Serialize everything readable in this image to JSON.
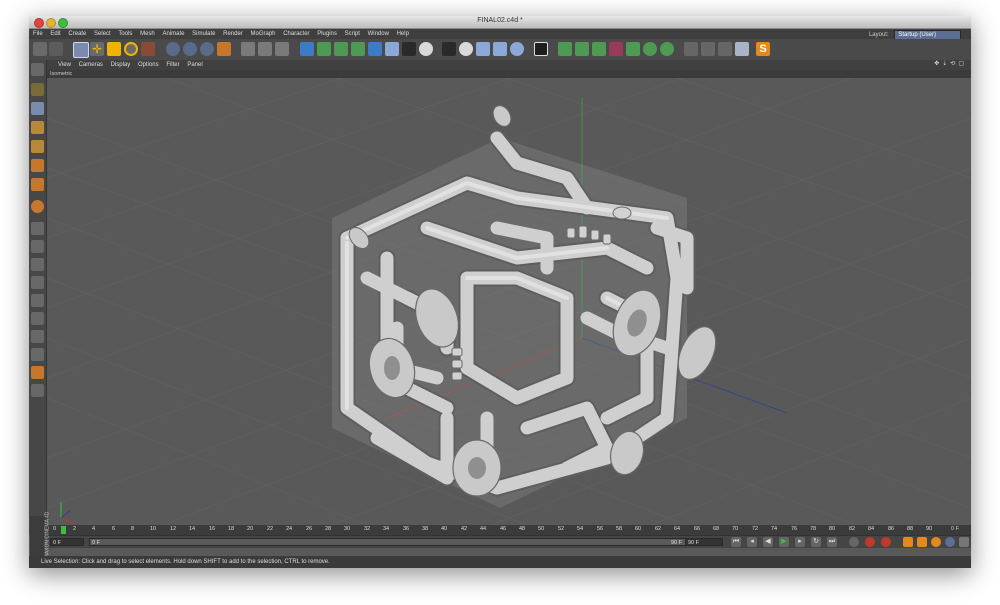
{
  "window": {
    "title": "FINAL02.c4d *"
  },
  "menubar": {
    "items": [
      "File",
      "Edit",
      "Create",
      "Select",
      "Tools",
      "Mesh",
      "Animate",
      "Simulate",
      "Render",
      "MoGraph",
      "Character",
      "Plugins",
      "Script",
      "Window",
      "Help"
    ],
    "layout_label": "Layout:",
    "layout_value": "Startup (User)"
  },
  "viewport_menu": {
    "items": [
      "View",
      "Cameras",
      "Display",
      "Options",
      "Filter",
      "Panel"
    ]
  },
  "viewport": {
    "name": "Isometric"
  },
  "timeline": {
    "ticks": [
      "0",
      "2",
      "4",
      "6",
      "8",
      "10",
      "12",
      "14",
      "16",
      "18",
      "20",
      "22",
      "24",
      "26",
      "28",
      "30",
      "32",
      "34",
      "36",
      "38",
      "40",
      "42",
      "44",
      "46",
      "48",
      "50",
      "52",
      "54",
      "56",
      "58",
      "60",
      "62",
      "64",
      "66",
      "68",
      "70",
      "72",
      "74",
      "76",
      "78",
      "80",
      "82",
      "84",
      "86",
      "88",
      "90"
    ],
    "current_frame": "0 F"
  },
  "transport": {
    "start_field": "0 F",
    "range_start": "0 F",
    "range_end": "90 F",
    "end_field": "90 F"
  },
  "brand": "MAXON CINEMA 4D",
  "status": {
    "text": "Live Selection: Click and drag to select elements. Hold down SHIFT to add to the selection, CTRL to remove."
  },
  "colors": {
    "accent": "#5a6f93",
    "viewport": "#595959",
    "axis_x": "#c0392b",
    "axis_y": "#2ecc40",
    "axis_z": "#2c3e9c"
  }
}
